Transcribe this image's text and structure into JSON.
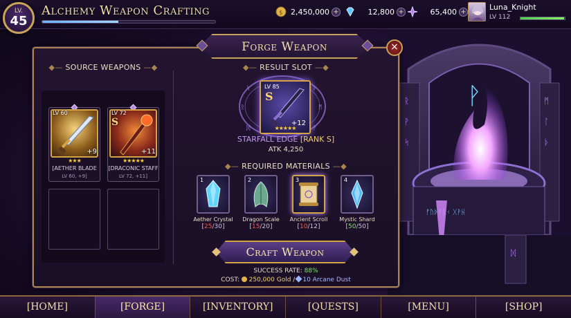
{
  "topbar": {
    "level_label": "LV.",
    "level": "45",
    "title": "Alchemy Weapon Crafting",
    "xp_fraction": 0.44,
    "currencies": [
      {
        "icon": "gold-coin-icon",
        "value": "2,450,000"
      },
      {
        "icon": "gem-icon",
        "value": "12,800"
      },
      {
        "icon": "arcane-dust-icon",
        "value": "65,400"
      }
    ],
    "add_symbol": "+",
    "player": {
      "name": "Luna_Knight",
      "level": "LV 112",
      "hp_fraction": 0.98
    }
  },
  "panel": {
    "title": "Forge Weapon",
    "close_symbol": "×",
    "source_heading": "SOURCE WEAPONS",
    "result_heading": "RESULT SLOT",
    "materials_heading": "REQUIRED MATERIALS",
    "heading_ornament": "—◆—"
  },
  "source_weapons": [
    {
      "level": "LV 60",
      "rank": "",
      "plus": "+9",
      "stars": "★★★",
      "name": "[AETHER BLADE",
      "sub": "LV 60, +9]"
    },
    {
      "level": "LV 72",
      "rank": "S",
      "plus": "+11",
      "stars": "★★★★★",
      "name": "[DRACONIC STAFF",
      "sub": "LV 72, +11]"
    }
  ],
  "result": {
    "level": "LV 85",
    "rank": "S",
    "plus": "+12",
    "stars": "★★★★★",
    "name": "STARFALL EDGE",
    "rank_tag": "[RANK S]",
    "atk": "ATK 4,250"
  },
  "materials": [
    {
      "index": "1",
      "name": "Aether Crystal",
      "have": "25",
      "need": "30",
      "ok": false
    },
    {
      "index": "2",
      "name": "Dragon Scale",
      "have": "15",
      "need": "20",
      "ok": false
    },
    {
      "index": "3",
      "name": "Ancient Scroll",
      "have": "10",
      "need": "12",
      "ok": false
    },
    {
      "index": "4",
      "name": "Mystic Shard",
      "have": "50",
      "need": "50",
      "ok": true
    }
  ],
  "craft": {
    "button_label": "Craft Weapon",
    "success_label": "SUCCESS RATE:",
    "success_value": "88%",
    "cost_label": "COST:",
    "cost_gold": "250,000 Gold",
    "cost_sep": "/",
    "cost_dust": "10 Arcane Dust"
  },
  "nav": {
    "items": [
      "[HOME]",
      "[FORGE]",
      "[INVENTORY]",
      "[QUESTS]",
      "[MENU]",
      "[SHOP]"
    ],
    "active_index": 1
  },
  "colors": {
    "accent_gold": "#d4a447",
    "panel_bg": "#1a0f26",
    "magic_purple": "#b88cff",
    "ok_green": "#7bea6a",
    "short_red": "#ff5a4a"
  }
}
